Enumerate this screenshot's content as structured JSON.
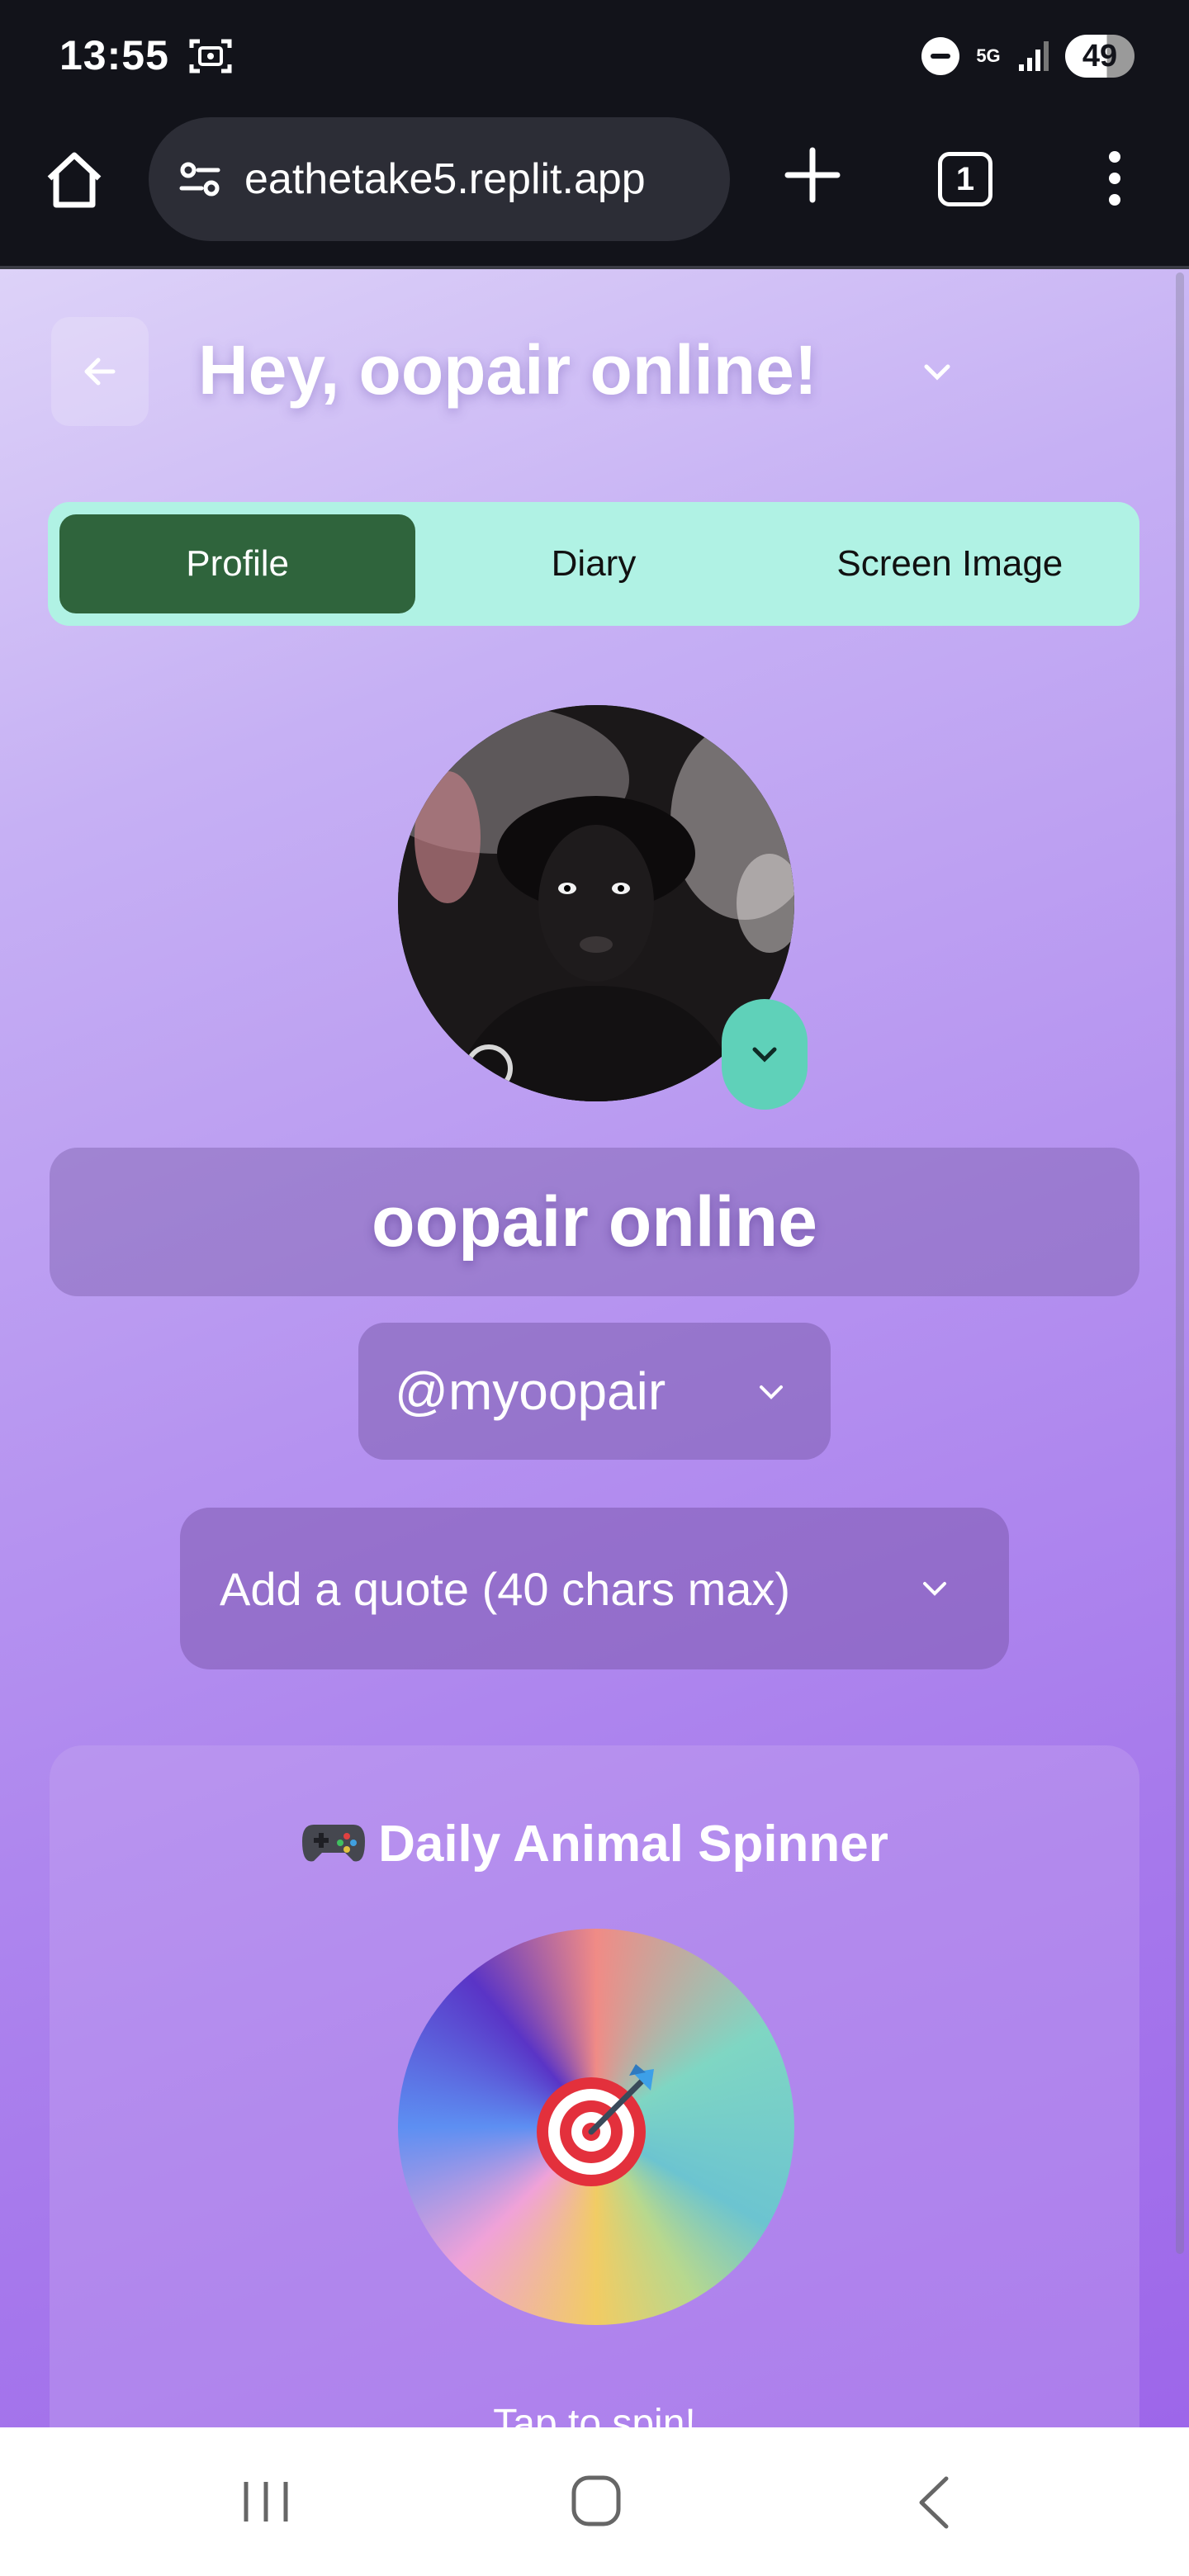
{
  "status_bar": {
    "time": "13:55",
    "network": "5G",
    "battery": "49",
    "icons": [
      "screenshot-icon",
      "do-not-disturb-icon",
      "signal-icon"
    ]
  },
  "browser": {
    "url": "eathetake5.replit.app",
    "tab_count": "1",
    "icons": [
      "home-icon",
      "site-settings-icon",
      "plus-icon",
      "more-vert-icon"
    ]
  },
  "header": {
    "greeting": "Hey, oopair online!",
    "icons": [
      "arrow-left-icon",
      "chevron-down-icon"
    ]
  },
  "tabs": [
    {
      "label": "Profile",
      "active": true
    },
    {
      "label": "Diary",
      "active": false
    },
    {
      "label": "Screen Image",
      "active": false
    }
  ],
  "profile": {
    "display_name": "oopair online",
    "handle": "@myoopair",
    "quote_placeholder": "Add a quote (40 chars max)"
  },
  "spinner": {
    "title": "Daily Animal Spinner",
    "title_icon": "gamepad-icon",
    "center_icon": "dart-target-icon",
    "hint": "Tap to spin!"
  },
  "colors": {
    "accent_teal": "#b0f2e4",
    "active_tab": "#2f643c",
    "avatar_button": "#5fd1b9",
    "page_gradient_start": "#ddd2f8",
    "page_gradient_end": "#9d66ea"
  }
}
